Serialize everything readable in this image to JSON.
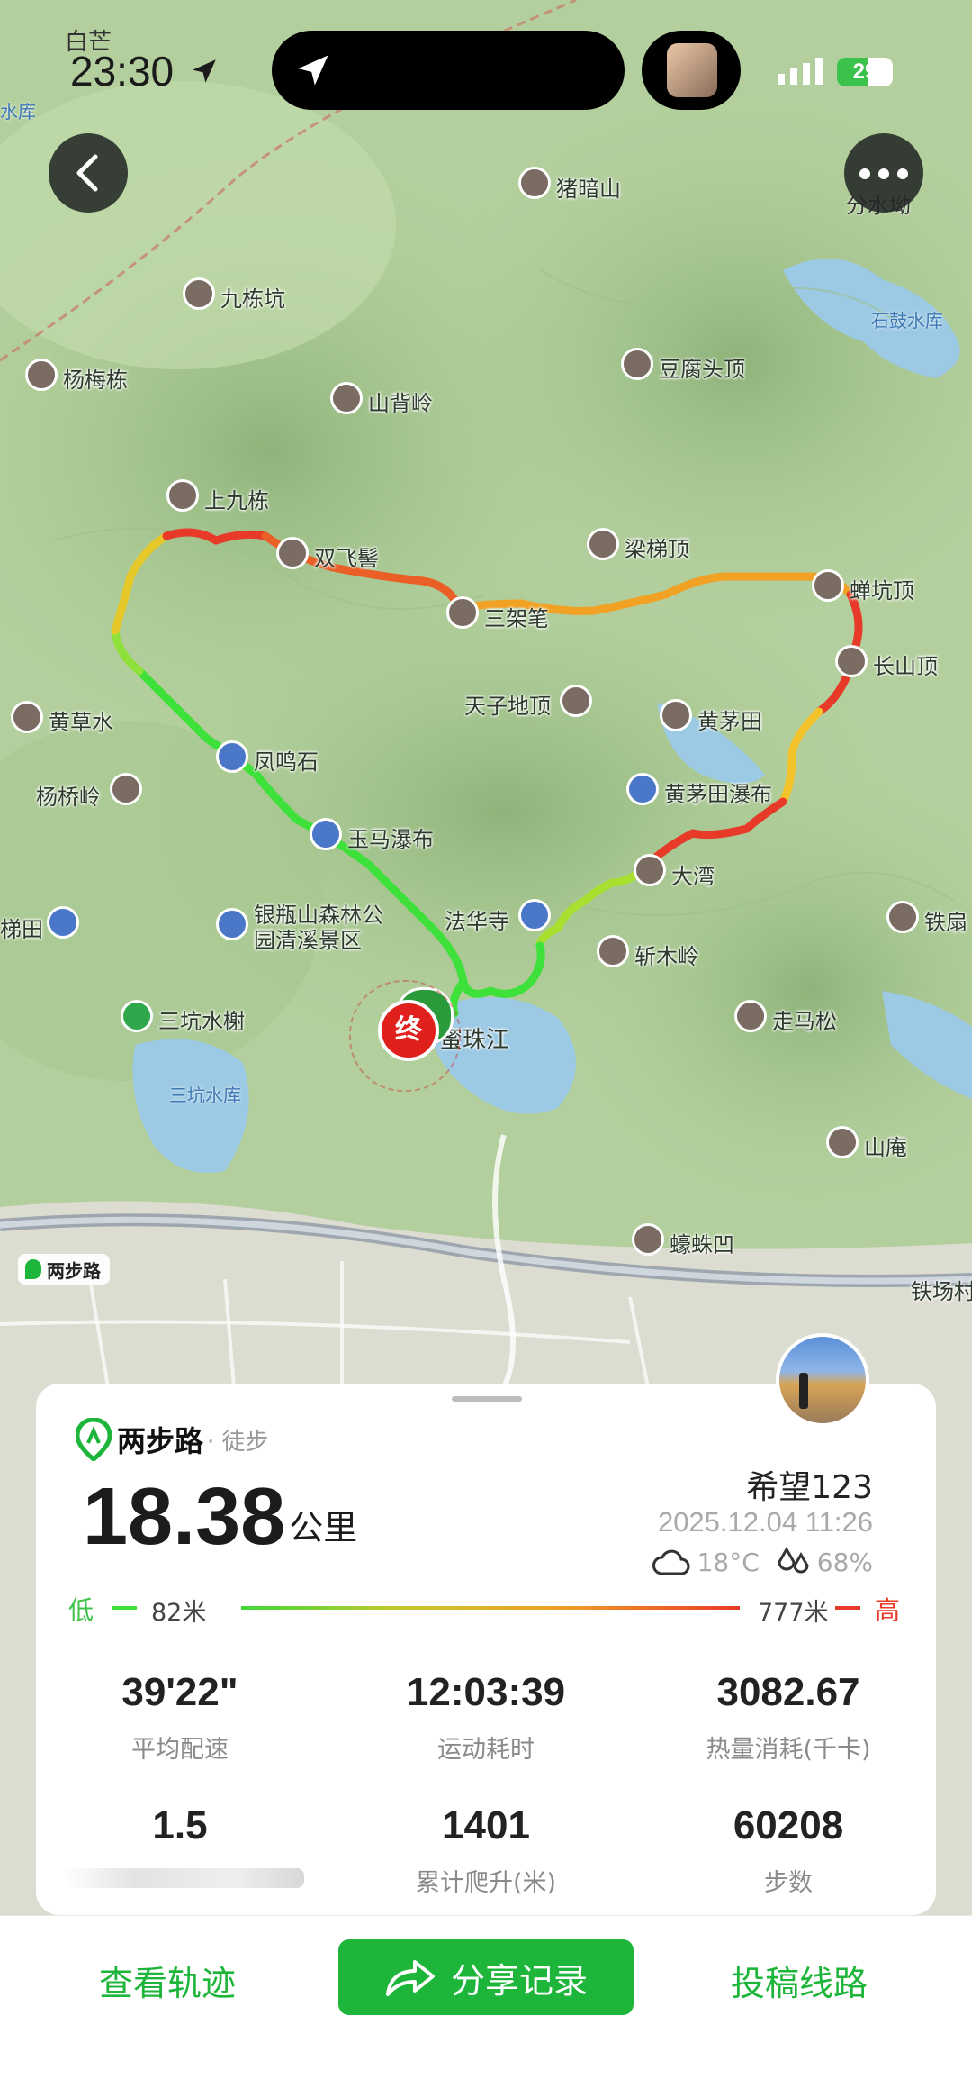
{
  "status_bar": {
    "time": "23:30",
    "location_small": "白芒",
    "battery": "29"
  },
  "map": {
    "peaks": [
      {
        "name": "猪暗山"
      },
      {
        "name": "九栋坑"
      },
      {
        "name": "杨梅栋"
      },
      {
        "name": "山背岭"
      },
      {
        "name": "豆腐头顶"
      },
      {
        "name": "上九栋"
      },
      {
        "name": "双飞髻"
      },
      {
        "name": "梁梯顶"
      },
      {
        "name": "蝉坑顶"
      },
      {
        "name": "三架笔"
      },
      {
        "name": "长山顶"
      },
      {
        "name": "天子地顶"
      },
      {
        "name": "黄茅田"
      },
      {
        "name": "黄草水"
      },
      {
        "name": "杨桥岭"
      },
      {
        "name": "大湾"
      },
      {
        "name": "铁扇"
      },
      {
        "name": "斩木岭"
      },
      {
        "name": "走马松"
      },
      {
        "name": "山庵"
      },
      {
        "name": "蠔蛛凹"
      }
    ],
    "pois": [
      {
        "name": "凤鸣石"
      },
      {
        "name": "玉马瀑布"
      },
      {
        "name": "黄茅田瀑布"
      },
      {
        "name": "法华寺"
      },
      {
        "name": "银瓶山森林公园清溪景区"
      },
      {
        "name": "梯田"
      },
      {
        "name": "三坑水榭"
      }
    ],
    "water_labels": [
      "水库",
      "分水坳",
      "石鼓水库",
      "三坑水库"
    ],
    "other_labels": [
      "蜜珠江",
      "铁场村"
    ],
    "end_marker": "终",
    "watermark": "两步路"
  },
  "card": {
    "brand": "两步路",
    "activity_type": "· 徒步",
    "distance": "18.38",
    "distance_unit": "公里",
    "username": "希望123",
    "datetime": "2025.12.04 11:26",
    "temperature": "18°C",
    "humidity": "68%",
    "elevation_low_label": "低",
    "elevation_low_value": "82米",
    "elevation_high_value": "777米",
    "elevation_high_label": "高",
    "stats": [
      {
        "value": "39'22\"",
        "label": "平均配速"
      },
      {
        "value": "12:03:39",
        "label": "运动耗时"
      },
      {
        "value": "3082.67",
        "label": "热量消耗(千卡)"
      },
      {
        "value": "1.5",
        "label": ""
      },
      {
        "value": "1401",
        "label": "累计爬升(米)"
      },
      {
        "value": "60208",
        "label": "步数"
      }
    ]
  },
  "bottom_bar": {
    "view_track": "查看轨迹",
    "share": "分享记录",
    "submit_route": "投稿线路"
  },
  "colors": {
    "brand_green": "#1db53a",
    "track_low": "#3ee03a",
    "track_high": "#e83a28"
  }
}
